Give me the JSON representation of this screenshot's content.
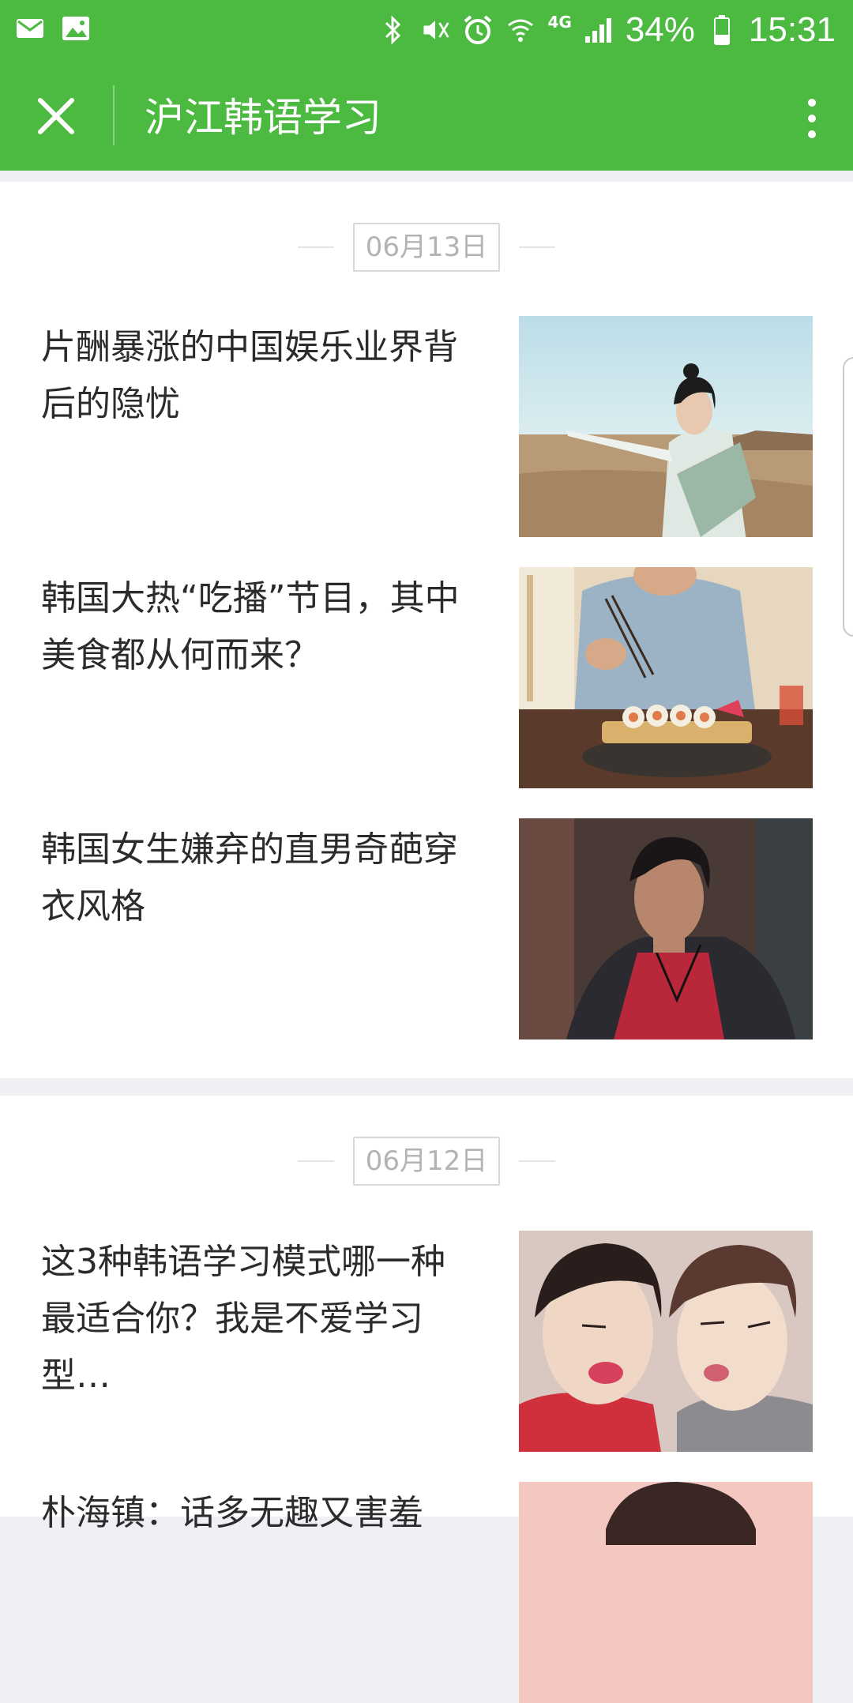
{
  "status_bar": {
    "left_icons": [
      "mail-icon",
      "image-icon"
    ],
    "right_icons": [
      "bluetooth-icon",
      "vibrate-mute-icon",
      "alarm-icon",
      "wifi-icon",
      "signal-icon",
      "battery-icon"
    ],
    "network": "4G",
    "battery": "34%",
    "time": "15:31",
    "color": "#4cb940"
  },
  "titlebar": {
    "close_icon": "close-icon",
    "title": "沪江韩语学习",
    "more_icon": "more-vertical-icon"
  },
  "sections": [
    {
      "date": "06月13日",
      "articles": [
        {
          "title": "片酬暴涨的中国娱乐业界背后的隐忧"
        },
        {
          "title": "韩国大热“吃播”节目，其中美食都从何而来？"
        },
        {
          "title": "韩国女生嫌弃的直男奇葩穿衣风格"
        }
      ]
    },
    {
      "date": "06月12日",
      "articles": [
        {
          "title": "这3种韩语学习模式哪一种最适合你？我是不爱学习型…"
        },
        {
          "title": "朴海镇：话多无趣又害羞"
        }
      ]
    }
  ]
}
